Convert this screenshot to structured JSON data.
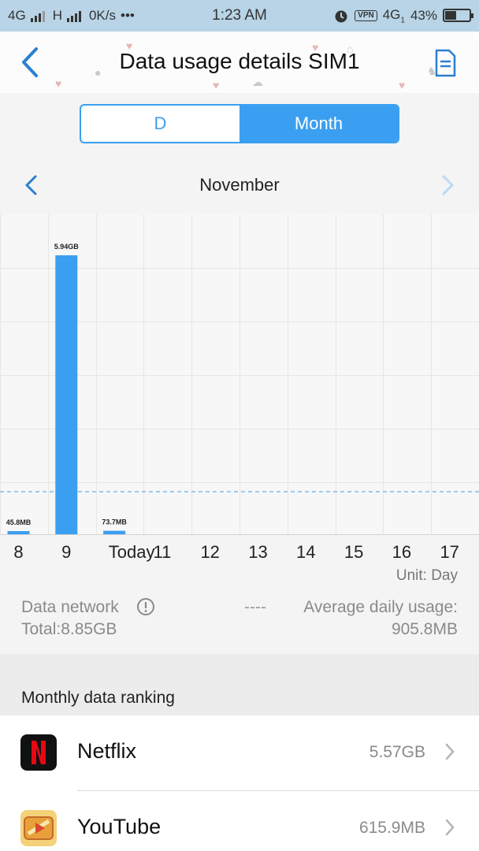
{
  "status_bar": {
    "network1": "4G",
    "network2": "H",
    "speed": "0K/s",
    "more": "•••",
    "time": "1:23 AM",
    "vpn": "VPN",
    "network3": "4G",
    "sim_index": "1",
    "battery": "43%",
    "icons": [
      "signal-icon",
      "alarm-icon",
      "battery-icon"
    ]
  },
  "header": {
    "title": "Data usage details SIM1",
    "back_icon": "back-arrow-icon",
    "export_icon": "export-document-icon"
  },
  "toggle": {
    "options": [
      "D",
      "Month"
    ],
    "selected": "Month"
  },
  "month_nav": {
    "label": "November",
    "prev_icon": "chevron-left-icon",
    "next_icon": "chevron-right-icon"
  },
  "chart_data": {
    "type": "bar",
    "categories": [
      "8",
      "9",
      "Today",
      "11",
      "12",
      "13",
      "14",
      "15",
      "16",
      "17"
    ],
    "values": [
      45.8,
      5940,
      73.7,
      0,
      0,
      0,
      0,
      0,
      0,
      0
    ],
    "value_unit": "MB",
    "data_labels": [
      "45.8MB",
      "5.94GB",
      "73.7MB",
      "",
      "",
      "",
      "",
      "",
      "",
      ""
    ],
    "reference_line": {
      "label": "Average daily usage",
      "value": 905.8,
      "style": "dashed"
    },
    "grid": true,
    "bar_color": "#3a9ff0",
    "title": "",
    "xlabel": "",
    "ylabel": ""
  },
  "unit_label": "Unit: Day",
  "summary": {
    "network_label": "Data network",
    "total": "Total:8.85GB",
    "dashes": "----",
    "avg_label": "Average daily usage:",
    "avg_value": "905.8MB"
  },
  "ranking": {
    "title": "Monthly data ranking",
    "apps": [
      {
        "name": "Netflix",
        "size": "5.57GB",
        "icon": "netflix-icon"
      },
      {
        "name": "YouTube",
        "size": "615.9MB",
        "icon": "youtube-icon"
      }
    ]
  },
  "colors": {
    "accent": "#3a9ff0",
    "status_bar": "#b8d4e6",
    "netflix_red": "#e50914"
  }
}
